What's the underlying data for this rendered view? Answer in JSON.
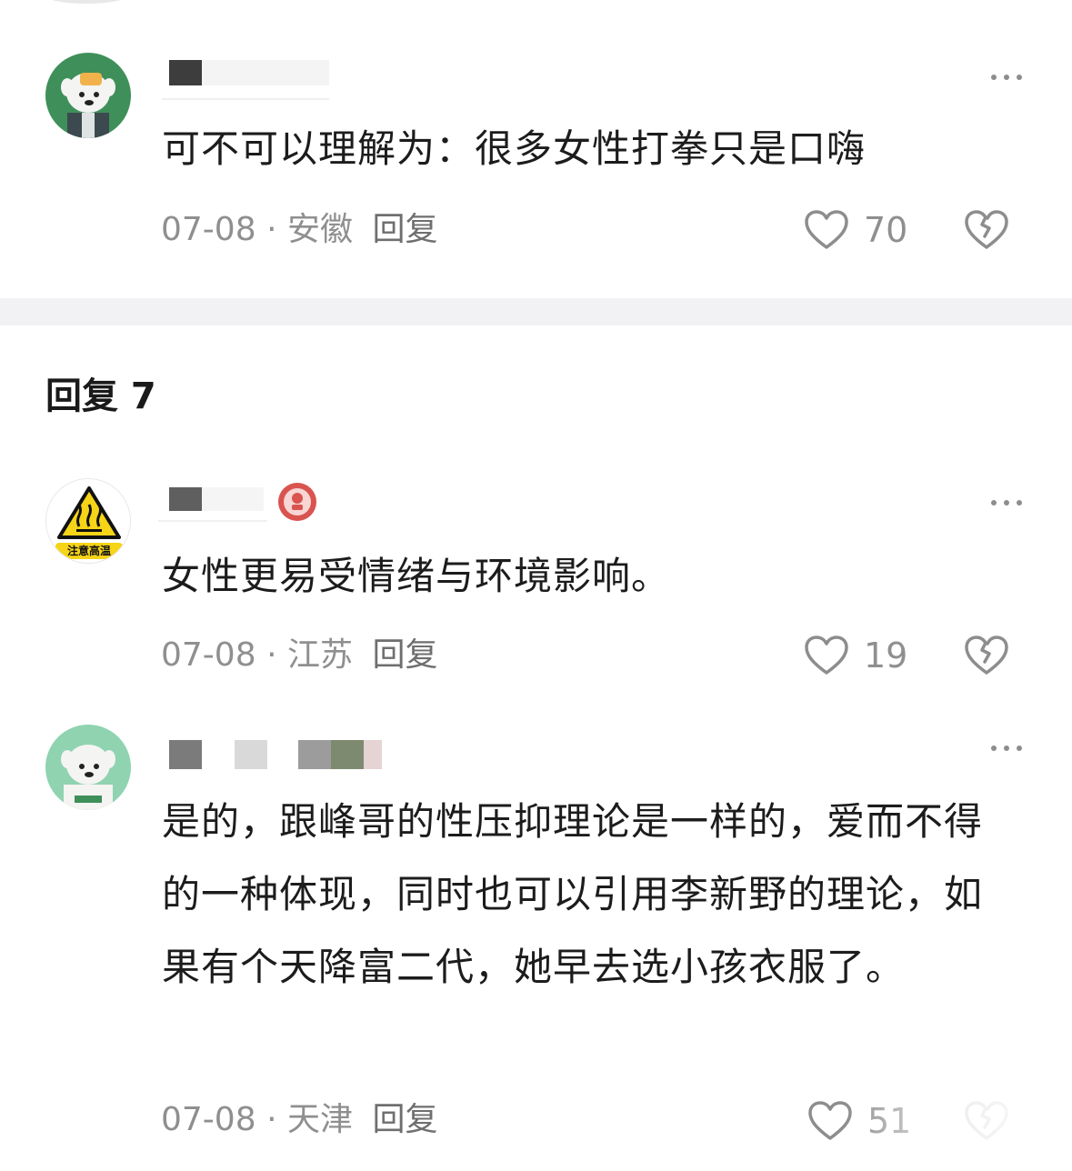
{
  "section": {
    "title": "回复 7"
  },
  "comments": [
    {
      "text": "可不可以理解为：很多女性打拳只是口嗨",
      "date": "07-08",
      "separator": "·",
      "location": "安徽",
      "reply_label": "回复",
      "likes": "70"
    },
    {
      "text": "女性更易受情绪与环境影响。",
      "date": "07-08",
      "separator": "·",
      "location": "江苏",
      "reply_label": "回复",
      "likes": "19",
      "avatar_caption": "注意高温"
    },
    {
      "text": "是的，跟峰哥的性压抑理论是一样的，爱而不得的一种体现，同时也可以引用李新野的理论，如果有个天降富二代，她早去选小孩衣服了。",
      "date": "07-08",
      "separator": "·",
      "location": "天津",
      "reply_label": "回复",
      "likes": "51"
    }
  ],
  "colors": {
    "text": "#1c1c1c",
    "meta": "#8f8f8f",
    "divider": "#f2f2f4",
    "icon": "#8d8d8d"
  }
}
